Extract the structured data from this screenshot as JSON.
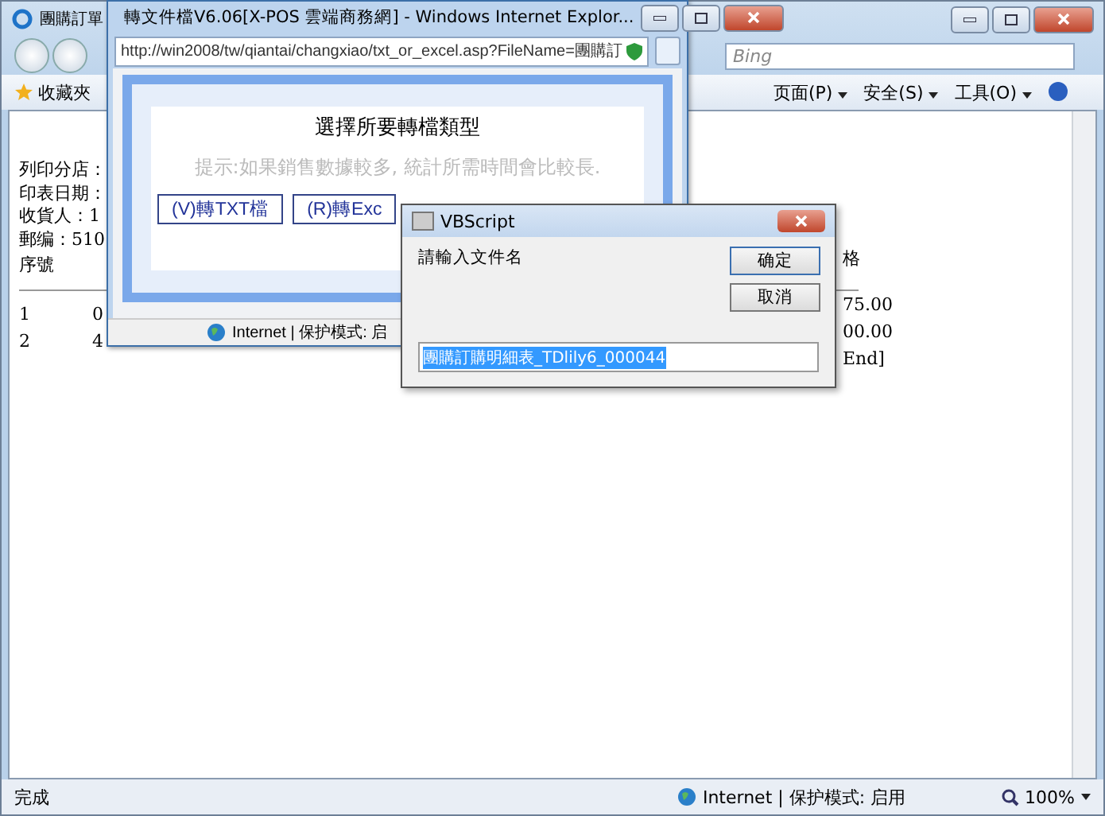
{
  "browser": {
    "tab_title": "團購訂單",
    "search": {
      "placeholder": "Bing"
    },
    "favorites": "收藏夾",
    "menus": [
      "页面(P)",
      "安全(S)",
      "工具(O)"
    ],
    "info_lines": [
      "列印分店：",
      "印表日期：",
      "收貨人：1",
      "郵编：510"
    ],
    "table_header": "序號",
    "rows": [
      [
        "1",
        "0"
      ],
      [
        "2",
        "4"
      ]
    ],
    "right_header": "格",
    "right_values": [
      "75.00",
      "00.00"
    ],
    "right_footer": "End]",
    "status": "完成",
    "zone": "Internet | 保护模式: 启用",
    "zoom": "100%"
  },
  "popup": {
    "title": "轉文件檔V6.06[X-POS 雲端商務網] - Windows Internet Explor...",
    "url": "http://win2008/tw/qiantai/changxiao/txt_or_excel.asp?FileName=團購訂",
    "heading": "選擇所要轉檔類型",
    "hint": "提示:如果銷售數據較多, 統計所需時間會比較長.",
    "buttons": [
      "(V)轉TXT檔",
      "(R)轉Exc"
    ],
    "zone": "Internet | 保护模式: 启"
  },
  "dialog": {
    "title": "VBScript",
    "prompt": "請輸入文件名",
    "buttons": [
      "确定",
      "取消"
    ],
    "value": "團購訂購明細表_TDlily6_000044"
  }
}
